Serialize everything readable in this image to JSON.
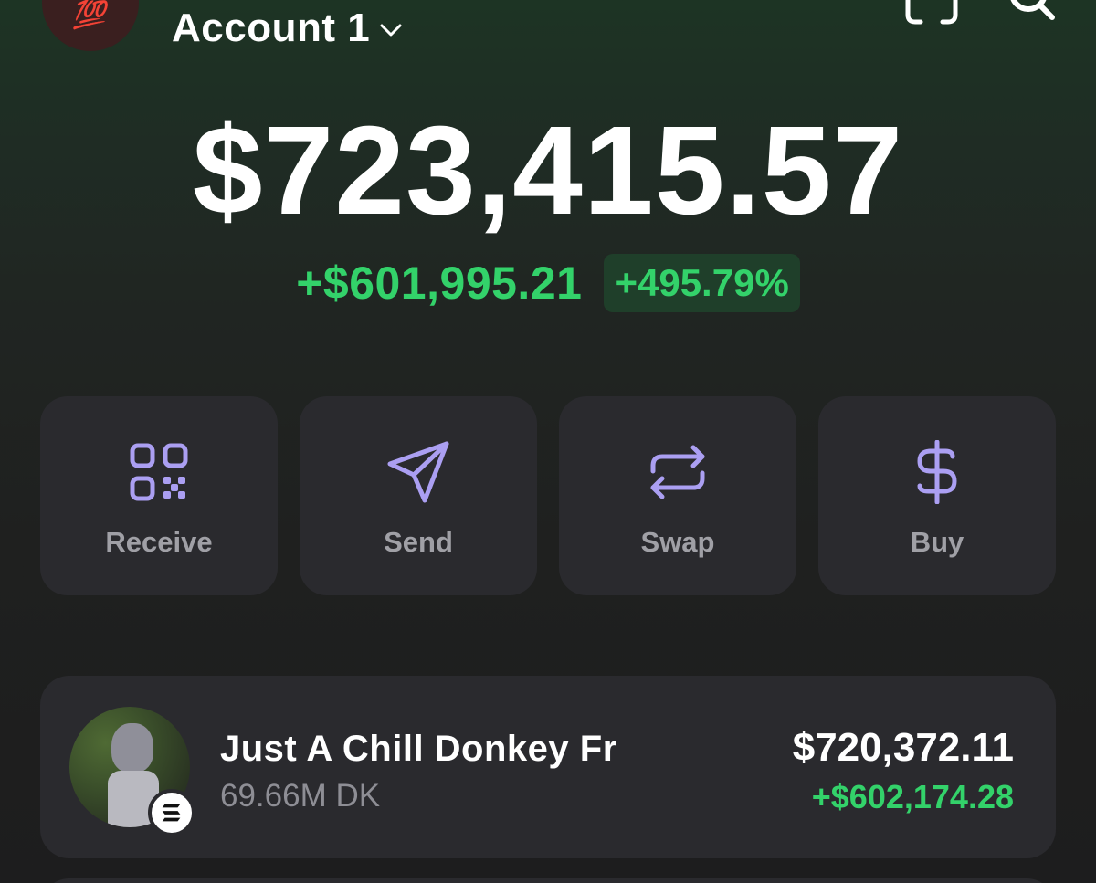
{
  "header": {
    "account_name": "Account 1",
    "avatar_emoji": "💯"
  },
  "portfolio": {
    "balance": "$723,415.57",
    "change_value": "+$601,995.21",
    "change_percent": "+495.79%"
  },
  "actions": [
    {
      "label": "Receive",
      "icon": "qr-code-icon"
    },
    {
      "label": "Send",
      "icon": "send-icon"
    },
    {
      "label": "Swap",
      "icon": "swap-icon"
    },
    {
      "label": "Buy",
      "icon": "dollar-icon"
    }
  ],
  "tokens": [
    {
      "name": "Just A Chill Donkey Fr",
      "amount": "69.66M DK",
      "value": "$720,372.11",
      "change": "+$602,174.28",
      "chain_icon": "solana-icon"
    }
  ],
  "colors": {
    "positive": "#33d26a",
    "accent": "#ab9ff2",
    "card": "#2a2a2e"
  }
}
